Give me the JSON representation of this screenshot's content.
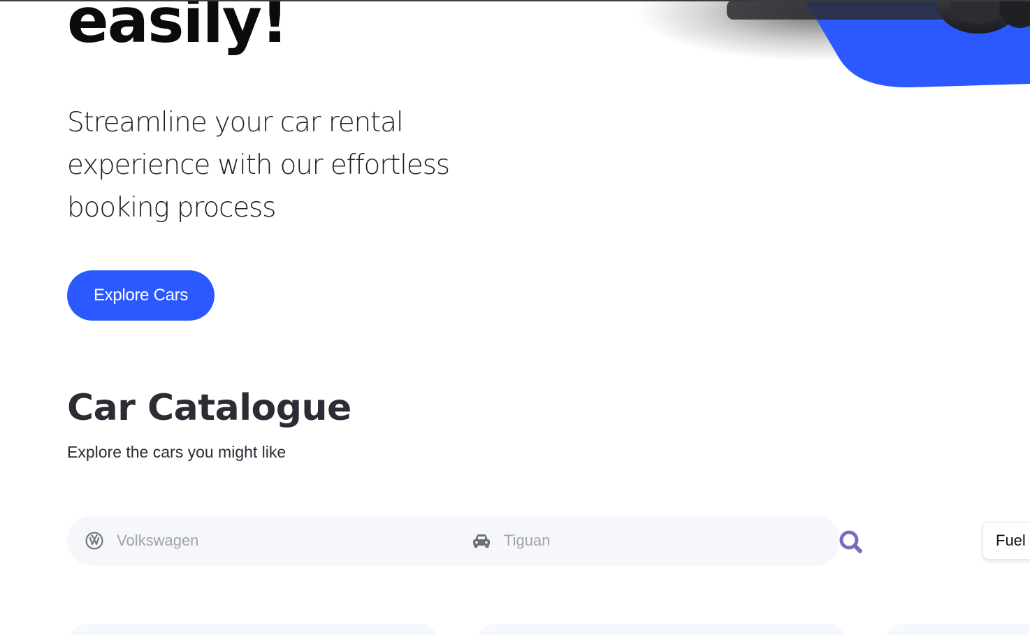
{
  "hero": {
    "title": "easily!",
    "subtitle": "Streamline your car rental experience with our effortless booking process",
    "cta_label": "Explore Cars"
  },
  "catalogue": {
    "title": "Car Catalogue",
    "subtitle": "Explore the cars you might like"
  },
  "search": {
    "make_placeholder": "Volkswagen",
    "model_placeholder": "Tiguan",
    "make_icon": "volkswagen-logo-icon",
    "model_icon": "car-icon",
    "submit_icon": "magnifying-glass-icon"
  },
  "filters": {
    "fuel_label": "Fuel"
  },
  "colors": {
    "primary": "#2b59ff",
    "search_icon": "#7c6bbd",
    "search_bg": "#f5f7fa",
    "heading": "#2b2c35"
  }
}
